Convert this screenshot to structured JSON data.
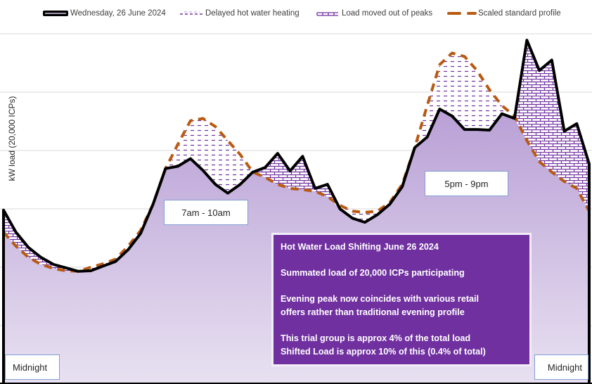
{
  "chart_data": {
    "type": "line",
    "title": "",
    "xlabel": "",
    "ylabel": "kW load (20,000 ICPs)",
    "y_units_note": "No tick labels shown; values in gridline units (each gridline = 1 unit)",
    "ylim": [
      0,
      6
    ],
    "grid": true,
    "legend_position": "top",
    "x_start_label": "Midnight",
    "x_end_label": "Midnight",
    "x_count": 48,
    "legend": [
      {
        "key": "actual",
        "label": "Wednesday, 26 June 2024"
      },
      {
        "key": "delayed",
        "label": "Delayed hot water heating"
      },
      {
        "key": "moved",
        "label": "Load moved out of peaks"
      },
      {
        "key": "profile",
        "label": "Scaled standard profile"
      }
    ],
    "series": [
      {
        "name": "Wednesday, 26 June 2024",
        "values": [
          2.98,
          2.6,
          2.34,
          2.17,
          2.05,
          1.99,
          1.93,
          1.94,
          2.02,
          2.1,
          2.3,
          2.58,
          3.08,
          3.69,
          3.73,
          3.86,
          3.66,
          3.42,
          3.27,
          3.42,
          3.63,
          3.71,
          3.95,
          3.65,
          3.9,
          3.35,
          3.42,
          3.0,
          2.84,
          2.77,
          2.9,
          3.08,
          3.38,
          4.05,
          4.23,
          4.71,
          4.59,
          4.36,
          4.36,
          4.35,
          4.63,
          4.55,
          5.89,
          5.37,
          5.55,
          4.33,
          4.46,
          3.77
        ]
      },
      {
        "name": "Scaled standard profile",
        "values": [
          2.6,
          2.36,
          2.17,
          2.05,
          1.98,
          1.94,
          1.93,
          2.0,
          2.06,
          2.14,
          2.36,
          2.63,
          3.08,
          3.69,
          4.11,
          4.51,
          4.55,
          4.41,
          4.17,
          3.93,
          3.63,
          3.54,
          3.42,
          3.35,
          3.33,
          3.3,
          3.21,
          3.06,
          2.96,
          2.94,
          2.96,
          3.11,
          3.42,
          4.05,
          4.77,
          5.47,
          5.67,
          5.61,
          5.37,
          5.04,
          4.77,
          4.59,
          4.17,
          3.81,
          3.63,
          3.47,
          3.35,
          2.96
        ]
      }
    ]
  },
  "annotations": {
    "morning_label": "7am - 10am",
    "evening_label": "5pm - 9pm",
    "midnight_left": "Midnight",
    "midnight_right": "Midnight"
  },
  "info_box": {
    "title": "Hot Water Load Shifting June 26 2024",
    "line1": "Summated load of 20,000 ICPs participating",
    "line2a": "Evening peak now coincides with various retail",
    "line2b": "offers rather than traditional evening profile",
    "line3a": "This trial group is approx 4% of the total load",
    "line3b": "Shifted Load is approx 10% of  this (0.4% of total)"
  },
  "colors": {
    "actual_line": "#000000",
    "area_fill_top": "#bfa8d8",
    "area_fill_bottom": "#e6def0",
    "pattern": "#7030a0",
    "profile_line": "#b85a12",
    "info_bg": "#7030a0",
    "grid": "#d9d9d9"
  }
}
